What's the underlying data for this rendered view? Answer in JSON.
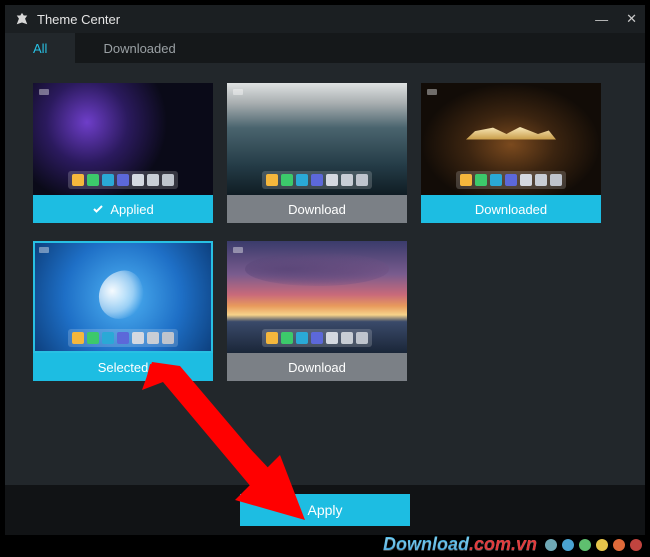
{
  "window": {
    "title": "Theme Center",
    "minimize": "—",
    "close": "✕"
  },
  "tabs": [
    {
      "label": "All",
      "active": true
    },
    {
      "label": "Downloaded",
      "active": false
    }
  ],
  "themes": [
    {
      "id": "galaxy",
      "status": "applied",
      "label": "Applied",
      "labelStyle": "cyan",
      "showCheck": true
    },
    {
      "id": "asteroid",
      "status": "download",
      "label": "Download",
      "labelStyle": "gray",
      "showCheck": false
    },
    {
      "id": "lineage",
      "status": "downloaded",
      "label": "Downloaded",
      "labelStyle": "cyan",
      "showCheck": false
    },
    {
      "id": "feather",
      "status": "selected",
      "label": "Selected",
      "labelStyle": "cyan",
      "showCheck": false
    },
    {
      "id": "sunset",
      "status": "download",
      "label": "Download",
      "labelStyle": "gray",
      "showCheck": false
    }
  ],
  "footer": {
    "apply_label": "Apply"
  },
  "watermark": {
    "text": "Download",
    "suffix": ".com.vn",
    "dot_colors": [
      "#6fa8b5",
      "#4aa3d1",
      "#5fbf6f",
      "#e6c44a",
      "#e06a3a",
      "#c1443f"
    ]
  },
  "colors": {
    "accent": "#1dbde2",
    "bg": "#22272b"
  }
}
